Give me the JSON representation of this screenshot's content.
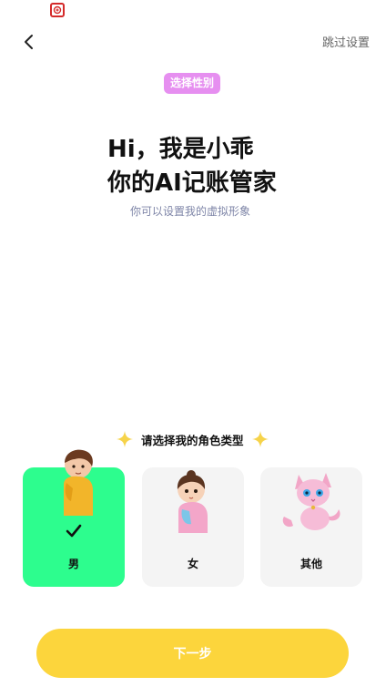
{
  "status_bar": {
    "icon": "app-notification-icon"
  },
  "header": {
    "back_icon": "chevron-left-icon",
    "skip_label": "跳过设置"
  },
  "step_tag": "选择性别",
  "greeting": {
    "line1": "Hi，我是小乖",
    "line2": "你的AI记账管家",
    "subtitle": "你可以设置我的虚拟形象"
  },
  "role_prompt": {
    "text": "请选择我的角色类型",
    "sparkle_icon": "sparkle-icon",
    "sparkle_color": "#f6d34a"
  },
  "roles": [
    {
      "label": "男",
      "selected": true,
      "avatar": "boy-avatar"
    },
    {
      "label": "女",
      "selected": false,
      "avatar": "girl-avatar"
    },
    {
      "label": "其他",
      "selected": false,
      "avatar": "cat-avatar"
    }
  ],
  "next_button": {
    "label": "下一步"
  },
  "colors": {
    "accent_green": "#2dfd8e",
    "accent_yellow": "#fcd53c",
    "tag_pink": "#e68ff0",
    "subtitle_text": "#7f86a8"
  }
}
